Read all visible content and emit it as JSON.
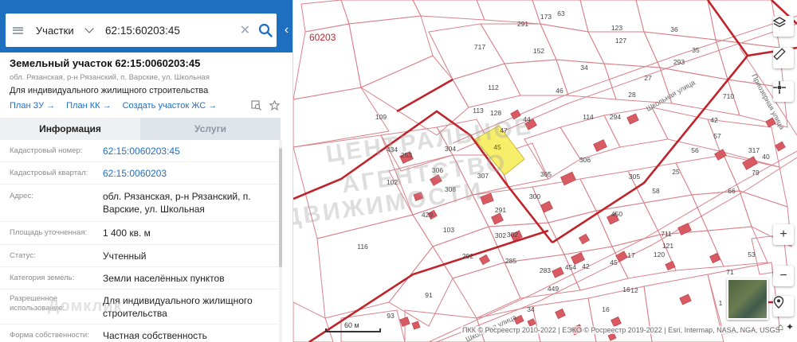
{
  "search": {
    "type_label": "Участки",
    "query": "62:15:60203:45"
  },
  "parcel": {
    "title": "Земельный участок 62:15:0060203:45",
    "address_short": "обл. Рязанская, р-н Рязанский, п. Варские, ул. Школьная",
    "use_line": "Для индивидуального жилищного строительства",
    "links": [
      "План ЗУ →",
      "План КК →",
      "Создать участок ЖС →"
    ]
  },
  "tabs": [
    "Информация",
    "Услуги"
  ],
  "info_rows": [
    {
      "label": "Кадастровый номер:",
      "value": "62:15:0060203:45"
    },
    {
      "label": "Кадастровый квартал:",
      "value": "62:15:0060203"
    },
    {
      "label": "Адрес:",
      "value": "обл. Рязанская, р-н Рязанский, п. Варские, ул. Школьная"
    },
    {
      "label": "Площадь уточненная:",
      "value": "1 400 кв. м"
    },
    {
      "label": "Статус:",
      "value": "Учтенный"
    },
    {
      "label": "Категория земель:",
      "value": "Земли населённых пунктов"
    },
    {
      "label": "Разрешенное использование:",
      "value": "Для индивидуального жилищного строительства"
    },
    {
      "label": "Форма собственности:",
      "value": "Частная собственность"
    }
  ],
  "panel_watermark": "Домклик",
  "map": {
    "quarter_label": "60203",
    "street_labels": [
      "Школьная улица",
      "Школьная улица",
      "Приозерная улица"
    ],
    "watermark": [
      "ЦЕНТРАЛЬНОЕ",
      "АГЕНТСТВО",
      "НЕДВИЖИМОСТИ"
    ],
    "parcel_numbers": [
      "291",
      "173",
      "63",
      "123",
      "127",
      "36",
      "152",
      "717",
      "34",
      "293",
      "35",
      "112",
      "46",
      "27",
      "28",
      "710",
      "113",
      "128",
      "44",
      "47",
      "114",
      "294",
      "109",
      "45",
      "42",
      "57",
      "56",
      "434",
      "304",
      "253",
      "306",
      "305",
      "306",
      "317",
      "305",
      "25",
      "79",
      "102",
      "308",
      "307",
      "300",
      "58",
      "66",
      "40",
      "429",
      "291",
      "450",
      "711",
      "103",
      "302",
      "302",
      "285",
      "116",
      "121",
      "120",
      "292",
      "283",
      "17",
      "454",
      "53",
      "16",
      "91",
      "449",
      "34",
      "93",
      "16",
      "12",
      "45",
      "42",
      "1",
      "71"
    ],
    "highlight_parcel": "45",
    "scale_label": "60 м",
    "attribution": "ПКК © Росреестр 2010-2022 | ЕЭКО © Росреестр 2019-2022 | Esri, Intermap, NASA, NGA, USGS",
    "colors": {
      "parcel_line": "#d9828a",
      "boundary": "#c0242b",
      "highlight": "#f7ef6a",
      "building": "#d85a63"
    }
  }
}
